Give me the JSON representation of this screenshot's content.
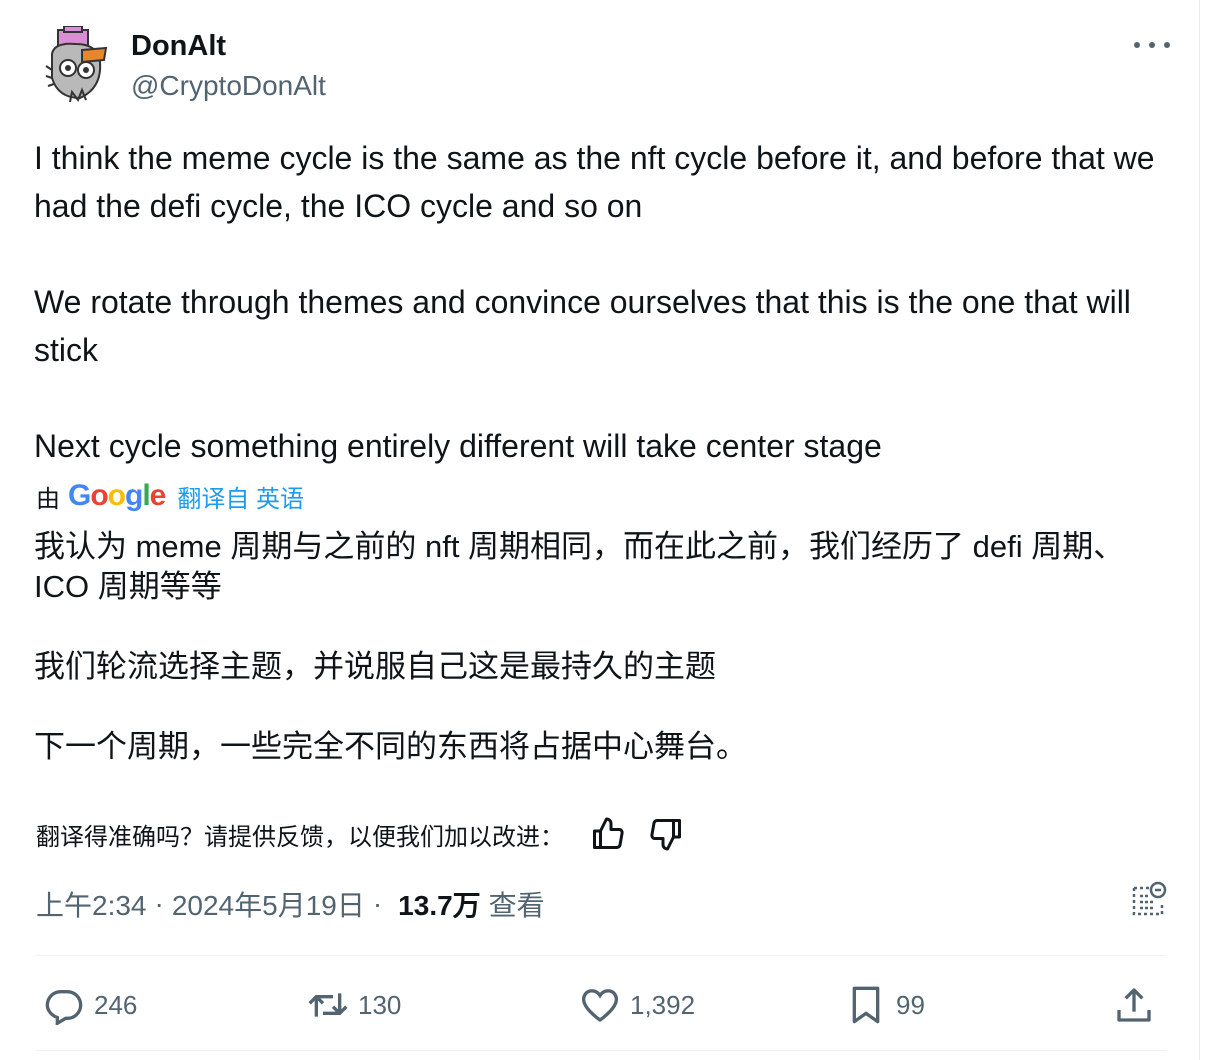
{
  "author": {
    "name": "DonAlt",
    "handle": "@CryptoDonAlt",
    "avatar_icon": "duck-avatar-icon",
    "more_icon": "more-horizontal-icon"
  },
  "tweet": {
    "paragraph_1": "I think the meme cycle is the same as the nft cycle before it, and before that we had the defi cycle, the ICO cycle and so on",
    "paragraph_2": "We rotate through themes and convince ourselves that this is the one that will stick",
    "paragraph_3": "Next cycle something entirely different will take center stage"
  },
  "translation": {
    "by_label": "由",
    "provider": "Google",
    "link_text": "翻译自 英语",
    "paragraph_1": "我认为 meme 周期与之前的 nft 周期相同，而在此之前，我们经历了 defi 周期、ICO 周期等等",
    "paragraph_2": "我们轮流选择主题，并说服自己这是最持久的主题",
    "paragraph_3": "下一个周期，一些完全不同的东西将占据中心舞台。",
    "feedback_prompt": "翻译得准确吗？请提供反馈，以便我们加以改进：",
    "thumbs_up_icon": "thumbs-up-icon",
    "thumbs_down_icon": "thumbs-down-icon"
  },
  "meta": {
    "time": "上午2:34",
    "separator": "·",
    "date": "2024年5月19日",
    "views_count": "13.7万",
    "views_label": "查看",
    "analytics_icon": "analytics-icon"
  },
  "actions": {
    "replies": "246",
    "reposts": "130",
    "likes": "1,392",
    "bookmarks": "99"
  },
  "colors": {
    "text": "#0f1419",
    "secondary": "#536471",
    "link": "#1d9bf0",
    "divider": "#eff3f4"
  }
}
